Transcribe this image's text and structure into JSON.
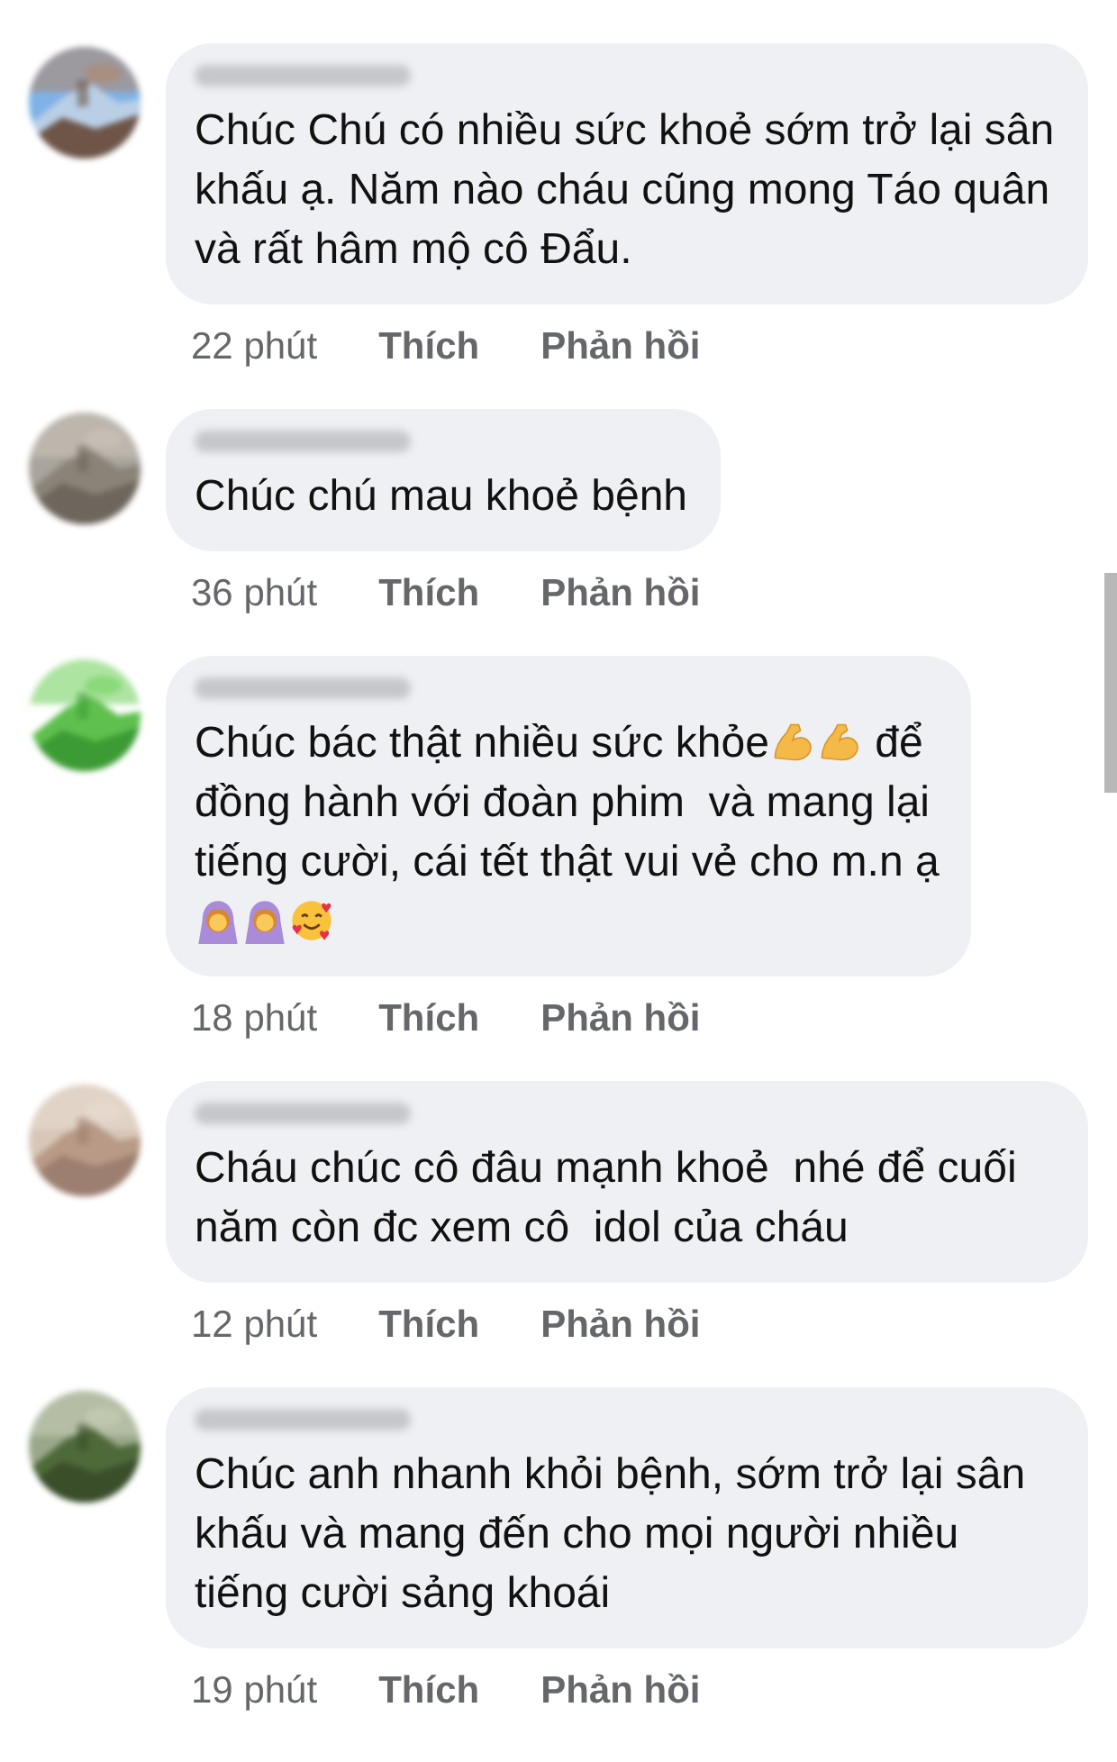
{
  "comments": [
    {
      "avatar": {
        "kind": "picture"
      },
      "text": "Chúc Chú có nhiều sức khoẻ sớm trở lại sân khấu ạ. Năm nào cháu cũng mong Táo quân và rất hâm mộ cô Đẩu.",
      "time": "22 phút",
      "like": "Thích",
      "reply": "Phản hồi"
    },
    {
      "avatar": {
        "kind": "picture"
      },
      "text": "Chúc chú mau khoẻ bệnh",
      "time": "36 phút",
      "like": "Thích",
      "reply": "Phản hồi"
    },
    {
      "avatar": {
        "kind": "picture"
      },
      "lines": [
        [
          {
            "kind": "text",
            "text": "Chúc bác thật nhiều sức khỏe"
          },
          {
            "kind": "muscle"
          },
          {
            "kind": "muscle"
          },
          {
            "kind": "text",
            "text": " để"
          }
        ],
        [
          {
            "kind": "text",
            "text": "đồng hành với đoàn phim  và mang lại"
          }
        ],
        [
          {
            "kind": "text",
            "text": "tiếng cười, cái tết thật vui vẻ cho m.n ạ"
          }
        ],
        [
          {
            "kind": "arms-up"
          },
          {
            "kind": "arms-up"
          },
          {
            "kind": "heart-face"
          }
        ]
      ],
      "time": "18 phút",
      "like": "Thích",
      "reply": "Phản hồi"
    },
    {
      "avatar": {
        "kind": "picture"
      },
      "text": "Cháu chúc cô đâu mạnh khoẻ  nhé để cuối năm còn đc xem cô  idol của cháu",
      "time": "12 phút",
      "like": "Thích",
      "reply": "Phản hồi"
    },
    {
      "avatar": {
        "kind": "picture"
      },
      "text": "Chúc anh nhanh khỏi bệnh, sớm trở lại sân khấu và mang đến cho mọi người nhiều tiếng cười sảng khoái",
      "time": "19 phút",
      "like": "Thích",
      "reply": "Phản hồi"
    }
  ]
}
